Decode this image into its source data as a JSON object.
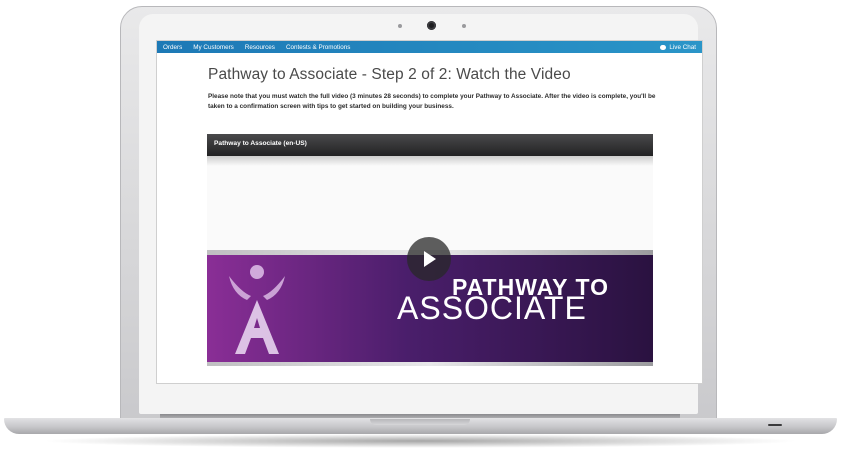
{
  "navbar": {
    "items": [
      {
        "label": "Orders"
      },
      {
        "label": "My Customers"
      },
      {
        "label": "Resources"
      },
      {
        "label": "Contests & Promotions"
      }
    ],
    "live_chat": "Live Chat"
  },
  "main": {
    "title": "Pathway to Associate - Step 2 of 2: Watch the Video",
    "intro": "Please note that you must watch the full video (3 minutes 28 seconds) to complete your Pathway to Associate. After the video is complete, you'll be taken to a confirmation screen with tips to get started on building your business."
  },
  "video": {
    "title": "Pathway to Associate (en-US)",
    "banner_line1": "PATHWAY TO",
    "banner_line2": "ASSOCIATE",
    "play_icon": "play-icon"
  },
  "colors": {
    "nav_bg": "#1d79b6",
    "banner_purple": "#4a1e6b",
    "banner_magenta": "#8a2e96"
  }
}
